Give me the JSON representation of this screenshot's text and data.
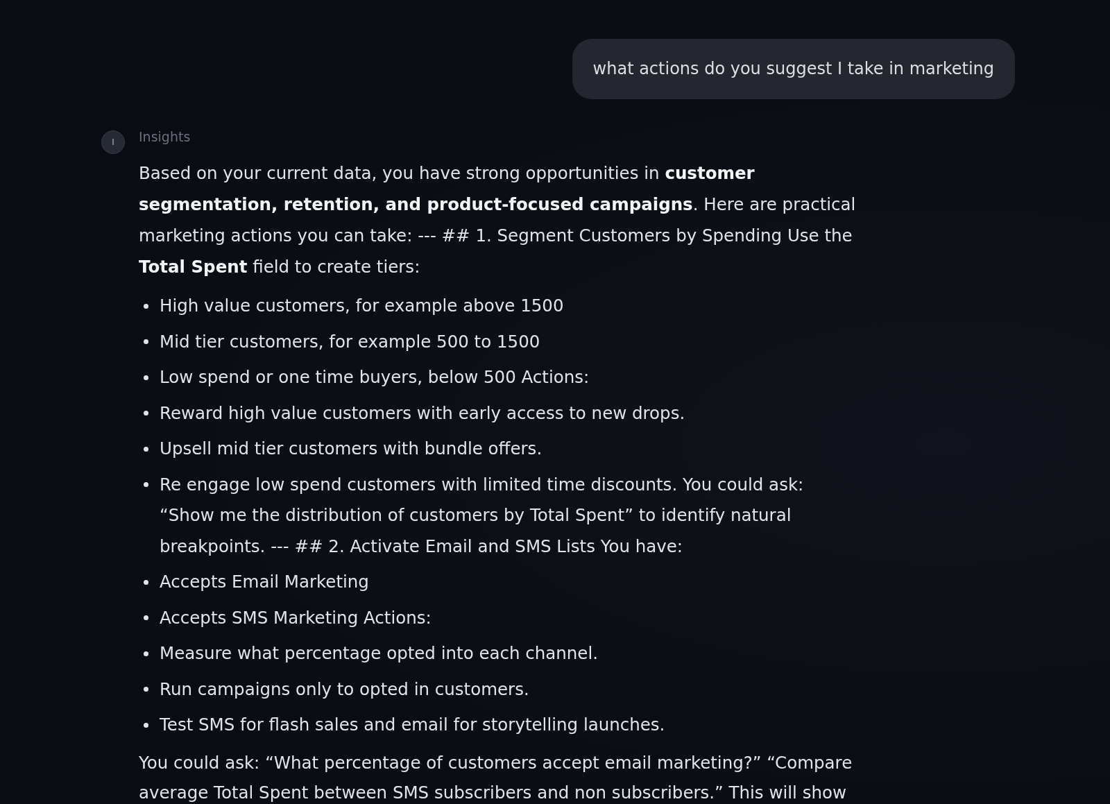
{
  "conversation": {
    "user_message": {
      "text": "what actions do you suggest I take in marketing"
    },
    "assistant_message": {
      "avatar_letter": "I",
      "sender": "Insights",
      "blocks": [
        {
          "kind": "paragraph",
          "text": "Based on your current data, you have strong opportunities in **customer segmentation, retention, and product-focused campaigns**. Here are practical marketing actions you can take: --- ## 1. Segment Customers by Spending Use the **Total Spent** field to create tiers:"
        },
        {
          "kind": "bullet_list",
          "items": [
            "High value customers, for example above 1500",
            "Mid tier customers, for example 500 to 1500",
            "Low spend or one time buyers, below 500 Actions:",
            "Reward high value customers with early access to new drops.",
            "Upsell mid tier customers with bundle offers.",
            "Re engage low spend customers with limited time discounts. You could ask: “Show me the distribution of customers by Total Spent” to identify natural breakpoints. --- ## 2. Activate Email and SMS Lists You have:",
            "Accepts Email Marketing",
            "Accepts SMS Marketing Actions:",
            "Measure what percentage opted into each channel.",
            "Run campaigns only to opted in customers.",
            "Test SMS for flash sales and email for storytelling launches."
          ]
        },
        {
          "kind": "paragraph",
          "text": "You could ask: “What percentage of customers accept email marketing?” “Compare average Total Spent between SMS subscribers and non subscribers.” This will show"
        }
      ]
    }
  }
}
